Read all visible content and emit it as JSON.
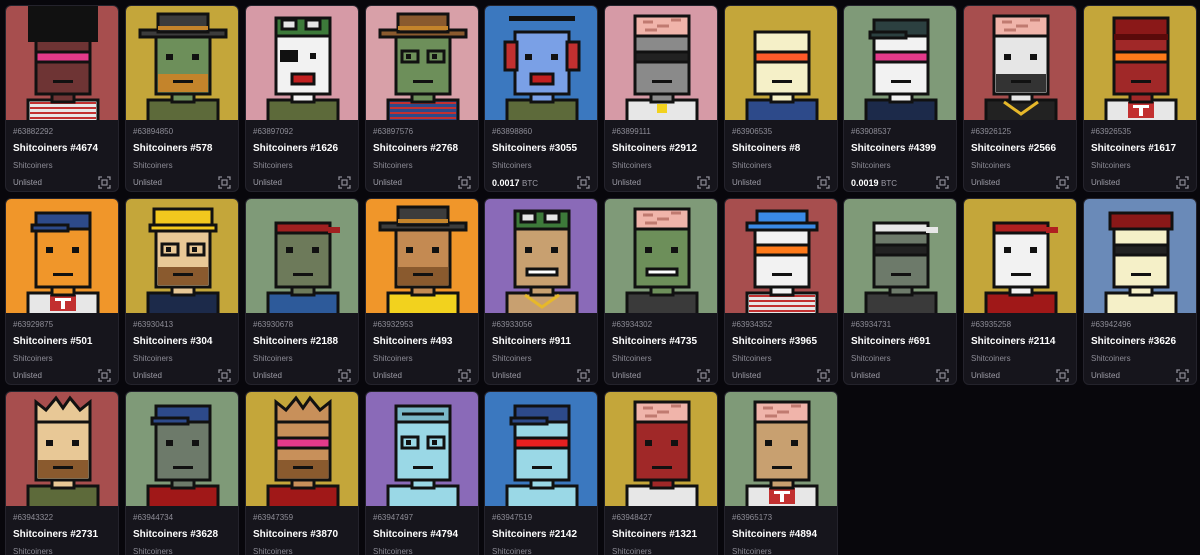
{
  "cards": [
    {
      "inscription": "#63882292",
      "name": "Shitcoiners #4674",
      "collection": "Shitcoiners",
      "status": "Unlisted",
      "bg": "#a74e4e",
      "skin": "#6e3434",
      "hat": "hair",
      "eyes": "shades",
      "shade": "#e43a8a",
      "shirt": "#e7e7e7",
      "stripe": true
    },
    {
      "inscription": "#63894850",
      "name": "Shitcoiners #578",
      "collection": "Shitcoiners",
      "status": "Unlisted",
      "bg": "#c4a63a",
      "skin": "#6d8f5a",
      "hat": "cowboy",
      "hatColor": "#3c3c3c",
      "eyes": "plain",
      "beard": "#c4842b",
      "shirt": "#5d6a3a"
    },
    {
      "inscription": "#63897092",
      "name": "Shitcoiners #1626",
      "collection": "Shitcoiners",
      "status": "Unlisted",
      "bg": "#d69aa6",
      "skin": "#f2f2f2",
      "hat": "army",
      "hatColor": "#3d7a3a",
      "eyes": "patch",
      "mouth": "red",
      "shirt": "#5d6a3a"
    },
    {
      "inscription": "#63897576",
      "name": "Shitcoiners #2768",
      "collection": "Shitcoiners",
      "status": "Unlisted",
      "bg": "#d8a0a8",
      "skin": "#6d8f5a",
      "hat": "cowboy",
      "hatColor": "#8a5a2e",
      "eyes": "glasses",
      "shirt": "#2d4a8a",
      "stripe": true
    },
    {
      "inscription": "#63898860",
      "name": "Shitcoiners #3055",
      "collection": "Shitcoiners",
      "status": "0.0017",
      "unit": "BTC",
      "listed": true,
      "bg": "#3b78bf",
      "skin": "#7aa0e6",
      "hat": "headphones",
      "hatColor": "#c23030",
      "eyes": "plain",
      "mouth": "red",
      "shirt": "#5d6a3a"
    },
    {
      "inscription": "#63899111",
      "name": "Shitcoiners #2912",
      "collection": "Shitcoiners",
      "status": "Unlisted",
      "bg": "#d69aa6",
      "skin": "#8a8a8a",
      "hat": "brain",
      "eyes": "shades",
      "shade": "#222222",
      "shirt": "#e7e7e7",
      "badge": true
    },
    {
      "inscription": "#63906535",
      "name": "Shitcoiners #8",
      "collection": "Shitcoiners",
      "status": "Unlisted",
      "bg": "#c4a63a",
      "skin": "#f5f0c8",
      "hat": "none",
      "eyes": "shades",
      "shade": "#ff5a2a",
      "shirt": "#2d4a8a"
    },
    {
      "inscription": "#63908537",
      "name": "Shitcoiners #4399",
      "collection": "Shitcoiners",
      "status": "0.0019",
      "unit": "BTC",
      "listed": true,
      "bg": "#7f9a78",
      "skin": "#f2f2f2",
      "hat": "cap",
      "hatColor": "#2c4040",
      "eyes": "shades",
      "shade": "#e43a8a",
      "shirt": "#1c2a4a"
    },
    {
      "inscription": "#63926125",
      "name": "Shitcoiners #2566",
      "collection": "Shitcoiners",
      "status": "Unlisted",
      "bg": "#a74e4e",
      "skin": "#e6e6e6",
      "hat": "brain",
      "eyes": "plain",
      "beard": "#333333",
      "shirt": "#222222",
      "chain": true
    },
    {
      "inscription": "#63926535",
      "name": "Shitcoiners #1617",
      "collection": "Shitcoiners",
      "status": "Unlisted",
      "bg": "#c4a63a",
      "skin": "#a02828",
      "hat": "beanie",
      "hatColor": "#8a1818",
      "eyes": "shades",
      "shade": "#ff7a1a",
      "shirt": "#e7e7e7",
      "logo": true
    },
    {
      "inscription": "#63929875",
      "name": "Shitcoiners #501",
      "collection": "Shitcoiners",
      "status": "Unlisted",
      "bg": "#f0962a",
      "skin": "#f0962a",
      "hat": "cap",
      "hatColor": "#2d4a8a",
      "eyes": "plain",
      "shirt": "#e7e7e7",
      "logo": true
    },
    {
      "inscription": "#63930413",
      "name": "Shitcoiners #304",
      "collection": "Shitcoiners",
      "status": "Unlisted",
      "bg": "#c4a63a",
      "skin": "#e8c896",
      "hat": "hardhat",
      "hatColor": "#f2c81e",
      "eyes": "glasses",
      "beard": "#8a5a2e",
      "shirt": "#1c2a4a"
    },
    {
      "inscription": "#63930678",
      "name": "Shitcoiners #2188",
      "collection": "Shitcoiners",
      "status": "Unlisted",
      "bg": "#7f9a78",
      "skin": "#6d7a5a",
      "hat": "bandana",
      "hatColor": "#a02020",
      "eyes": "plain",
      "shirt": "#2d5a9a"
    },
    {
      "inscription": "#63932953",
      "name": "Shitcoiners #493",
      "collection": "Shitcoiners",
      "status": "Unlisted",
      "bg": "#f0962a",
      "skin": "#c48a52",
      "hat": "cowboy",
      "hatColor": "#3c3c3c",
      "eyes": "plain",
      "beard": "#8a5a2e",
      "shirt": "#f2d21e"
    },
    {
      "inscription": "#63933056",
      "name": "Shitcoiners #911",
      "collection": "Shitcoiners",
      "status": "Unlisted",
      "bg": "#8a6ab8",
      "skin": "#c8a070",
      "hat": "army",
      "hatColor": "#3d7a3a",
      "eyes": "plain",
      "mouth": "teeth",
      "shirt": "#c8a070",
      "chain": true
    },
    {
      "inscription": "#63934302",
      "name": "Shitcoiners #4735",
      "collection": "Shitcoiners",
      "status": "Unlisted",
      "bg": "#7f9a78",
      "skin": "#6d8f5a",
      "hat": "brain",
      "eyes": "plain",
      "mouth": "teeth",
      "shirt": "#3a3a3a"
    },
    {
      "inscription": "#63934352",
      "name": "Shitcoiners #3965",
      "collection": "Shitcoiners",
      "status": "Unlisted",
      "bg": "#a74e4e",
      "skin": "#f2f2f2",
      "hat": "bucket",
      "hatColor": "#3a8ae6",
      "eyes": "shades",
      "shade": "#ff7a1a",
      "shirt": "#e7e7e7",
      "stripe": true
    },
    {
      "inscription": "#63934731",
      "name": "Shitcoiners #691",
      "collection": "Shitcoiners",
      "status": "Unlisted",
      "bg": "#7f9a78",
      "skin": "#6d7a6a",
      "hat": "bandana",
      "hatColor": "#e7e7e7",
      "eyes": "shades",
      "shade": "#222222",
      "shirt": "#3a3a3a"
    },
    {
      "inscription": "#63935258",
      "name": "Shitcoiners #2114",
      "collection": "Shitcoiners",
      "status": "Unlisted",
      "bg": "#c4a63a",
      "skin": "#f2f2f2",
      "hat": "bandana",
      "hatColor": "#b02020",
      "eyes": "plain",
      "shirt": "#a01818"
    },
    {
      "inscription": "#63942496",
      "name": "Shitcoiners #3626",
      "collection": "Shitcoiners",
      "status": "Unlisted",
      "bg": "#6a8ab8",
      "skin": "#f5f0c8",
      "hat": "beret",
      "hatColor": "#8a1818",
      "eyes": "shades",
      "shade": "#222222",
      "shirt": "#f5f0c8"
    },
    {
      "inscription": "#63943322",
      "name": "Shitcoiners #2731",
      "collection": "Shitcoiners",
      "status": "",
      "bg": "#a74e4e",
      "skin": "#e8c896",
      "hat": "crown",
      "hatColor": "#e8c896",
      "eyes": "plain",
      "beard": "#8a5a2e",
      "shirt": "#5d6a3a"
    },
    {
      "inscription": "#63944734",
      "name": "Shitcoiners #3628",
      "collection": "Shitcoiners",
      "status": "",
      "bg": "#7f9a78",
      "skin": "#6d7a6a",
      "hat": "cap",
      "hatColor": "#2d4a8a",
      "eyes": "plain",
      "shirt": "#a01818"
    },
    {
      "inscription": "#63947359",
      "name": "Shitcoiners #3870",
      "collection": "Shitcoiners",
      "status": "",
      "bg": "#c4a63a",
      "skin": "#c8905a",
      "hat": "crown",
      "hatColor": "#c8905a",
      "eyes": "shades",
      "shade": "#e43a8a",
      "beard": "#8a5a2e",
      "shirt": "#a01818"
    },
    {
      "inscription": "#63947497",
      "name": "Shitcoiners #4794",
      "collection": "Shitcoiners",
      "status": "",
      "bg": "#8a6ab8",
      "skin": "#9ad8e6",
      "hat": "frank",
      "hatColor": "#9ad8e6",
      "eyes": "glasses",
      "shirt": "#9ad8e6"
    },
    {
      "inscription": "#63947519",
      "name": "Shitcoiners #2142",
      "collection": "Shitcoiners",
      "status": "",
      "bg": "#3b78bf",
      "skin": "#9ad8e6",
      "hat": "cap",
      "hatColor": "#2d4a8a",
      "eyes": "shades",
      "shade": "#e62020",
      "shirt": "#9ad8e6"
    },
    {
      "inscription": "#63948427",
      "name": "Shitcoiners #1321",
      "collection": "Shitcoiners",
      "status": "",
      "bg": "#c4a63a",
      "skin": "#a02828",
      "hat": "brain",
      "eyes": "plain",
      "shirt": "#e7e7e7"
    },
    {
      "inscription": "#63965173",
      "name": "Shitcoiners #4894",
      "collection": "Shitcoiners",
      "status": "",
      "bg": "#7f9a78",
      "skin": "#c8a070",
      "hat": "brain",
      "eyes": "plain",
      "shirt": "#e7e7e7",
      "logo": true
    }
  ]
}
